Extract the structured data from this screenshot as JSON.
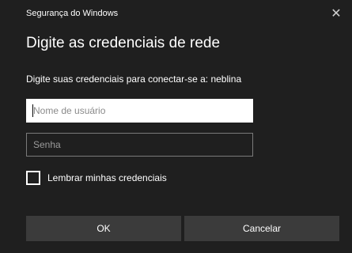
{
  "header": {
    "title": "Segurança do Windows",
    "close_glyph": "✕"
  },
  "main": {
    "title": "Digite as credenciais de rede",
    "prompt": "Digite suas credenciais para conectar-se a: neblina"
  },
  "fields": {
    "username_placeholder": "Nome de usuário",
    "username_value": "",
    "password_placeholder": "Senha",
    "password_value": ""
  },
  "remember": {
    "label": "Lembrar minhas credenciais",
    "checked": false
  },
  "buttons": {
    "ok": "OK",
    "cancel": "Cancelar"
  }
}
